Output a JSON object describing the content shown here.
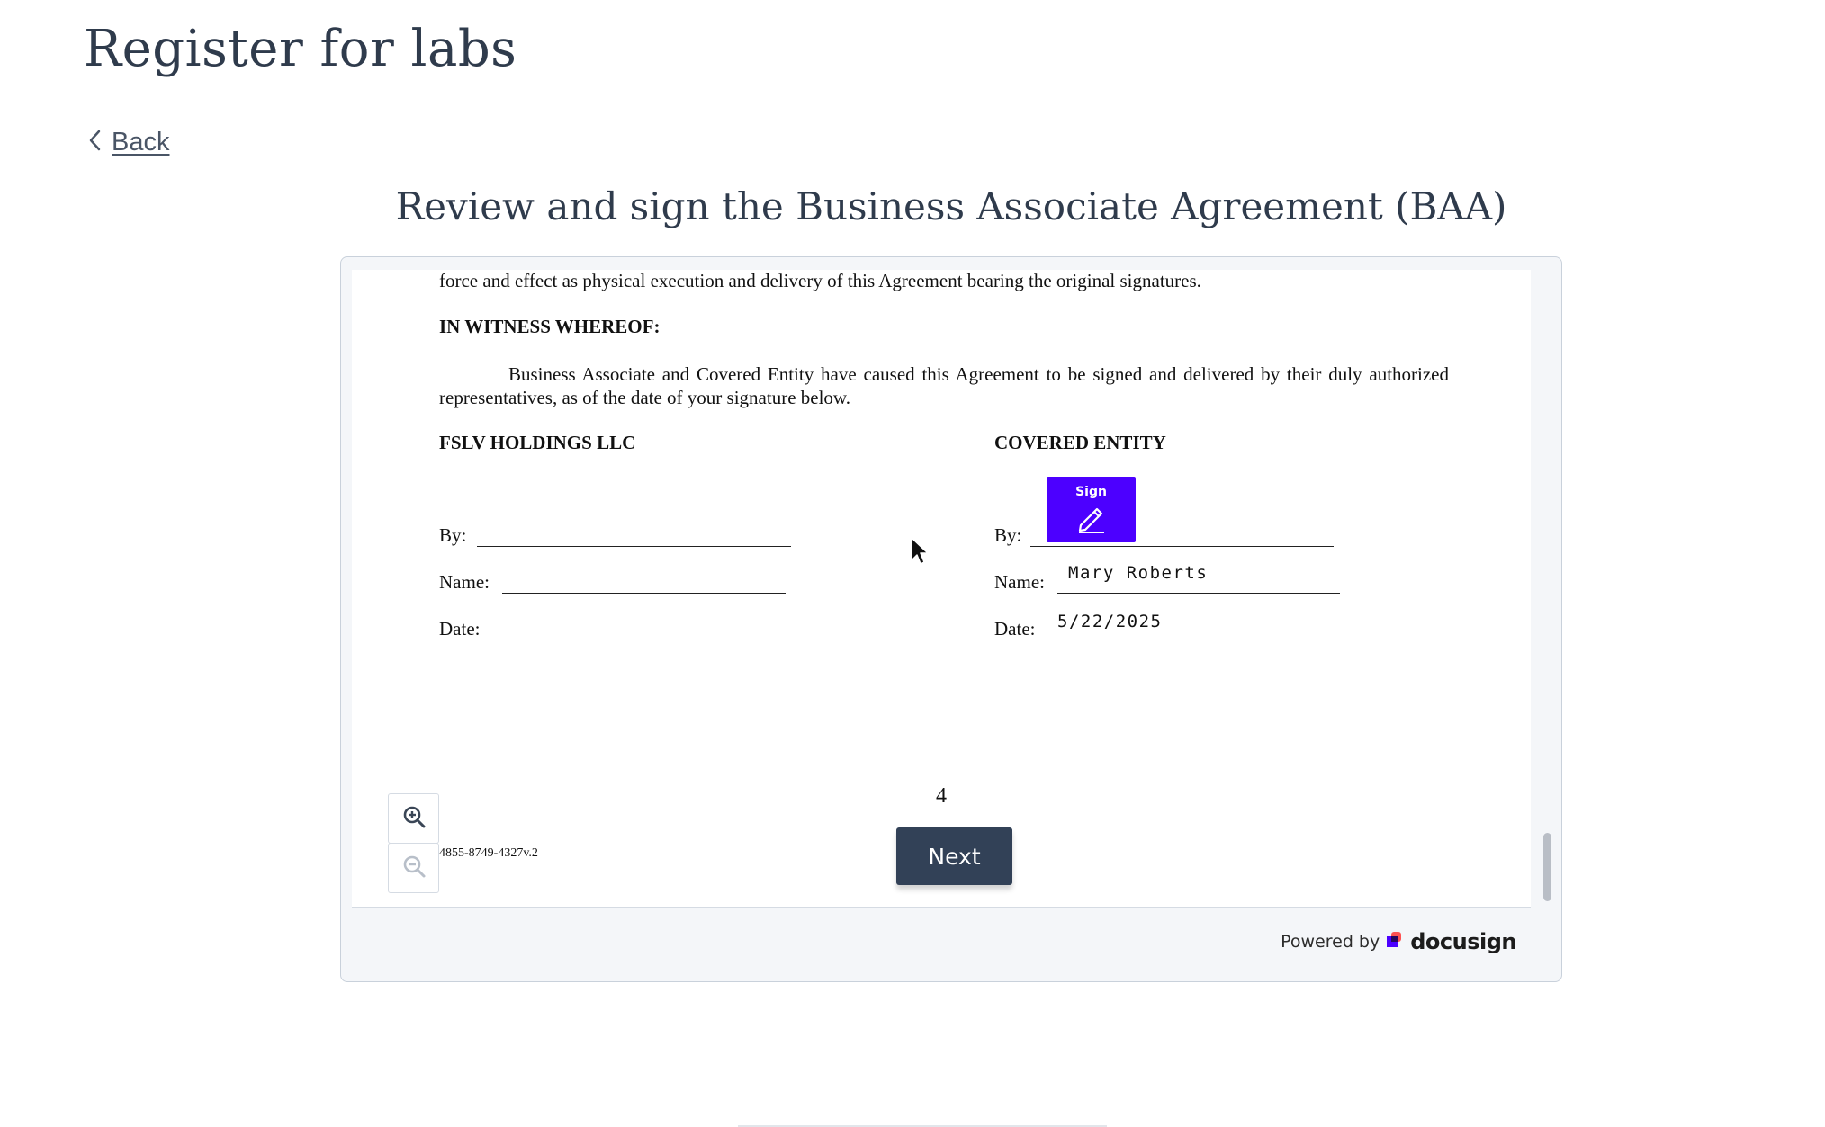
{
  "header": {
    "title": "Register for labs"
  },
  "nav": {
    "back_label": "Back"
  },
  "section": {
    "title": "Review and sign the Business Associate Agreement (BAA)"
  },
  "document": {
    "top_line": "force and effect as physical execution and delivery of this Agreement bearing the original signatures.",
    "witness_heading": "IN WITNESS WHEREOF:",
    "witness_paragraph": "Business Associate and Covered Entity have caused this Agreement to be signed and delivered by their duly authorized representatives, as of the date of your signature below.",
    "left_party": {
      "heading": "FSLV HOLDINGS LLC",
      "by_label": "By:",
      "name_label": "Name:",
      "date_label": "Date:"
    },
    "right_party": {
      "heading": "COVERED ENTITY",
      "by_label": "By:",
      "name_label": "Name:",
      "date_label": "Date:",
      "name_value": "Mary Roberts",
      "date_value": "5/22/2025"
    },
    "sign_tag_label": "Sign",
    "page_number": "4",
    "doc_reference": "4855-8749-4327v.2",
    "next_label": "Next"
  },
  "footer": {
    "powered_by": "Powered by",
    "brand": "docusign"
  },
  "colors": {
    "sign_accent": "#4c00ff",
    "next_button": "#324157",
    "text_primary": "#2f3b4c"
  },
  "icons": {
    "back": "chevron-left-icon",
    "zoom_in": "zoom-in-icon",
    "zoom_out": "zoom-out-icon",
    "sign": "pen-icon",
    "cursor": "mouse-pointer-icon"
  }
}
